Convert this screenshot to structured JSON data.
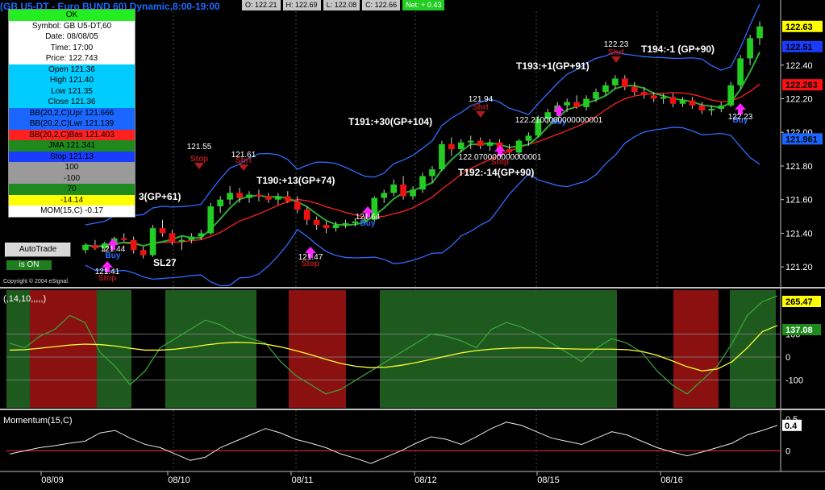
{
  "header": {
    "title": "(GB U5-DT - Euro BUND 60) Dynamic,8:00-19:00",
    "open": "O: 122.21",
    "high": "H: 122.69",
    "low": "L: 122.08",
    "close": "C: 122.66",
    "net": "Net: + 0.43"
  },
  "cursor_window": {
    "rows": [
      {
        "text": "OK",
        "bg": "#22ee22"
      },
      {
        "text": "Symbol: GB U5-DT,60",
        "bg": "#ffffff"
      },
      {
        "text": "Date: 08/08/05",
        "bg": "#ffffff"
      },
      {
        "text": "Time: 17:00",
        "bg": "#ffffff"
      },
      {
        "text": "Price: 122.743",
        "bg": "#ffffff"
      },
      {
        "text": "Open 121.36",
        "bg": "#00ccff"
      },
      {
        "text": "High 121.40",
        "bg": "#00ccff"
      },
      {
        "text": "Low 121.35",
        "bg": "#00ccff"
      },
      {
        "text": "Close 121.36",
        "bg": "#00ccff"
      },
      {
        "text": "BB(20,2,C)Upr 121.666",
        "bg": "#1a66ff"
      },
      {
        "text": "BB(20,2,C)Lwr 121.139",
        "bg": "#1a66ff"
      },
      {
        "text": "BB(20,2,C)Bas 121.403",
        "bg": "#ff2020"
      },
      {
        "text": "JMA 121.341",
        "bg": "#1e8a1e"
      },
      {
        "text": "Stop 121.13",
        "bg": "#1a3cff"
      },
      {
        "text": "100",
        "bg": "#9a9a9a"
      },
      {
        "text": "-100",
        "bg": "#9a9a9a"
      },
      {
        "text": "70",
        "bg": "#1e8a1e"
      },
      {
        "text": "-14.14",
        "bg": "#ffff00"
      },
      {
        "text": "MOM(15,C)  -0.17",
        "bg": "#ffffff"
      }
    ]
  },
  "controls": {
    "autotrade_label": "AutoTrade",
    "status_label": "is ON",
    "copyright": "Copyright © 2004 eSignal."
  },
  "chart_data": [
    {
      "type": "candlestick",
      "price_axis_ticks": [
        122.4,
        122.2,
        122.0,
        121.8,
        121.6,
        121.4,
        121.2
      ],
      "price_tags": [
        {
          "label": "122.63",
          "value": 122.63,
          "color": "#ffff00",
          "text": "#000000"
        },
        {
          "label": "122.51",
          "value": 122.51,
          "color": "#1a3cff",
          "text": "#000000"
        },
        {
          "label": "122.283",
          "value": 122.283,
          "color": "#ff1010",
          "text": "#000000"
        },
        {
          "label": "121.961",
          "value": 121.961,
          "color": "#1a66ff",
          "text": "#000000"
        }
      ],
      "trade_labels": [
        {
          "text": "T190:+13(GP+74)"
        },
        {
          "text": "T191:+30(GP+104)"
        },
        {
          "text": "T192:-14(GP+90)"
        },
        {
          "text": "T193:+1(GP+91)"
        },
        {
          "text": "T194:-1 (GP+90)"
        },
        {
          "text": "3(GP+61)"
        },
        {
          "text": "SL27"
        }
      ],
      "markers": [
        {
          "text": "Stop",
          "kind": "stop-short",
          "price": "121.55"
        },
        {
          "text": "Shrt",
          "kind": "short",
          "price": "121.61"
        },
        {
          "text": "Stop",
          "kind": "stop-long",
          "price": "121.41"
        },
        {
          "text": "Stop",
          "kind": "stop-long",
          "price": "121.47"
        },
        {
          "text": "Buy",
          "kind": "buy",
          "price": "121.64"
        },
        {
          "text": "Buy",
          "kind": "buy",
          "price": "121.44"
        },
        {
          "text": "Shrt",
          "kind": "short",
          "price": "121.94"
        },
        {
          "text": "Stop",
          "kind": "stop-long",
          "price": "122.070000000000001"
        },
        {
          "text": "Buy",
          "kind": "buy",
          "price": "122.2100000000000001"
        },
        {
          "text": "Shrt",
          "kind": "short",
          "price": "122.23"
        },
        {
          "text": "Buy",
          "kind": "buy",
          "price": "122.23"
        }
      ],
      "candles": [
        [
          121.3,
          121.34,
          121.28,
          121.33
        ],
        [
          121.33,
          121.36,
          121.3,
          121.31
        ],
        [
          121.31,
          121.35,
          121.29,
          121.34
        ],
        [
          121.34,
          121.38,
          121.32,
          121.37
        ],
        [
          121.37,
          121.4,
          121.35,
          121.36
        ],
        [
          121.36,
          121.38,
          121.28,
          121.3
        ],
        [
          121.3,
          121.32,
          121.25,
          121.27
        ],
        [
          121.27,
          121.45,
          121.26,
          121.43
        ],
        [
          121.43,
          121.48,
          121.38,
          121.4
        ],
        [
          121.4,
          121.42,
          121.33,
          121.35
        ],
        [
          121.35,
          121.38,
          121.3,
          121.36
        ],
        [
          121.36,
          121.4,
          121.34,
          121.38
        ],
        [
          121.38,
          121.42,
          121.36,
          121.4
        ],
        [
          121.4,
          121.58,
          121.39,
          121.56
        ],
        [
          121.56,
          121.62,
          121.52,
          121.6
        ],
        [
          121.6,
          121.68,
          121.57,
          121.64
        ],
        [
          121.64,
          121.67,
          121.58,
          121.61
        ],
        [
          121.61,
          121.65,
          121.58,
          121.63
        ],
        [
          121.63,
          121.66,
          121.59,
          121.62
        ],
        [
          121.62,
          121.64,
          121.58,
          121.6
        ],
        [
          121.6,
          121.64,
          121.57,
          121.62
        ],
        [
          121.62,
          121.65,
          121.58,
          121.59
        ],
        [
          121.59,
          121.62,
          121.52,
          121.54
        ],
        [
          121.54,
          121.56,
          121.45,
          121.48
        ],
        [
          121.48,
          121.5,
          121.42,
          121.45
        ],
        [
          121.45,
          121.47,
          121.4,
          121.43
        ],
        [
          121.43,
          121.47,
          121.41,
          121.45
        ],
        [
          121.45,
          121.48,
          121.43,
          121.46
        ],
        [
          121.46,
          121.49,
          121.44,
          121.47
        ],
        [
          121.47,
          121.5,
          121.45,
          121.48
        ],
        [
          121.48,
          121.62,
          121.47,
          121.61
        ],
        [
          121.61,
          121.66,
          121.58,
          121.64
        ],
        [
          121.64,
          121.72,
          121.62,
          121.69
        ],
        [
          121.69,
          121.74,
          121.6,
          121.62
        ],
        [
          121.62,
          121.68,
          121.6,
          121.66
        ],
        [
          121.66,
          121.76,
          121.64,
          121.74
        ],
        [
          121.74,
          121.8,
          121.7,
          121.78
        ],
        [
          121.78,
          121.95,
          121.77,
          121.93
        ],
        [
          121.93,
          121.97,
          121.86,
          121.9
        ],
        [
          121.9,
          121.96,
          121.88,
          121.94
        ],
        [
          121.94,
          121.98,
          121.9,
          121.95
        ],
        [
          121.95,
          121.97,
          121.9,
          121.92
        ],
        [
          121.92,
          121.96,
          121.89,
          121.94
        ],
        [
          121.94,
          121.96,
          121.88,
          121.9
        ],
        [
          121.9,
          121.93,
          121.86,
          121.88
        ],
        [
          121.88,
          121.96,
          121.86,
          121.95
        ],
        [
          121.95,
          122.0,
          121.92,
          121.98
        ],
        [
          121.98,
          122.1,
          121.97,
          122.08
        ],
        [
          122.08,
          122.14,
          122.05,
          122.12
        ],
        [
          122.12,
          122.18,
          122.1,
          122.16
        ],
        [
          122.16,
          122.2,
          122.12,
          122.18
        ],
        [
          122.18,
          122.22,
          122.14,
          122.15
        ],
        [
          122.15,
          122.22,
          122.13,
          122.2
        ],
        [
          122.2,
          122.26,
          122.18,
          122.24
        ],
        [
          122.24,
          122.3,
          122.22,
          122.28
        ],
        [
          122.28,
          122.34,
          122.26,
          122.32
        ],
        [
          122.32,
          122.34,
          122.25,
          122.27
        ],
        [
          122.27,
          122.3,
          122.22,
          122.24
        ],
        [
          122.24,
          122.27,
          122.2,
          122.22
        ],
        [
          122.22,
          122.24,
          122.18,
          122.2
        ],
        [
          122.2,
          122.23,
          122.17,
          122.21
        ],
        [
          122.21,
          122.23,
          122.15,
          122.17
        ],
        [
          122.17,
          122.21,
          122.15,
          122.19
        ],
        [
          122.19,
          122.21,
          122.14,
          122.16
        ],
        [
          122.16,
          122.18,
          122.11,
          122.13
        ],
        [
          122.13,
          122.16,
          122.1,
          122.14
        ],
        [
          122.14,
          122.18,
          122.12,
          122.16
        ],
        [
          122.16,
          122.3,
          122.15,
          122.28
        ],
        [
          122.28,
          122.46,
          122.26,
          122.44
        ],
        [
          122.44,
          122.58,
          122.4,
          122.56
        ],
        [
          122.56,
          122.66,
          122.52,
          122.63
        ]
      ]
    },
    {
      "type": "line",
      "label": "(,14,10,,,,,)",
      "axis_ticks": [
        "100",
        "0",
        "-100"
      ],
      "value_tags": [
        {
          "label": "265.47",
          "color": "#ffff00"
        },
        {
          "label": "137.08",
          "color": "#1e8a1e"
        }
      ],
      "cci": [
        60,
        40,
        90,
        120,
        180,
        150,
        20,
        -40,
        -120,
        -60,
        40,
        80,
        120,
        160,
        140,
        100,
        80,
        60,
        -20,
        -80,
        -120,
        -160,
        -140,
        -100,
        -60,
        -20,
        20,
        60,
        100,
        90,
        70,
        40,
        120,
        150,
        130,
        100,
        60,
        20,
        -20,
        40,
        80,
        60,
        20,
        -60,
        -120,
        -160,
        -100,
        -40,
        60,
        180,
        240,
        265
      ],
      "signal": [
        30,
        32,
        38,
        45,
        52,
        56,
        54,
        48,
        38,
        30,
        30,
        34,
        42,
        52,
        60,
        64,
        62,
        56,
        44,
        28,
        10,
        -10,
        -28,
        -40,
        -46,
        -44,
        -36,
        -24,
        -10,
        4,
        18,
        28,
        34,
        38,
        40,
        40,
        38,
        36,
        34,
        34,
        34,
        32,
        24,
        8,
        -16,
        -42,
        -60,
        -52,
        -20,
        40,
        110,
        137
      ],
      "zones": [
        {
          "color": "#1e5a1e"
        },
        {
          "color": "#8b1010"
        },
        {
          "color": "#1e5a1e"
        },
        {
          "color": "#000000"
        },
        {
          "color": "#1e5a1e"
        },
        {
          "color": "#000000"
        },
        {
          "color": "#8b1010"
        },
        {
          "color": "#000000"
        },
        {
          "color": "#1e5a1e"
        },
        {
          "color": "#000000"
        },
        {
          "color": "#8b1010"
        },
        {
          "color": "#000000"
        },
        {
          "color": "#1e5a1e"
        }
      ]
    },
    {
      "type": "line",
      "label": "Momentum(15,C)",
      "axis_ticks": [
        "0.5",
        "0"
      ],
      "value_tag": "0.4",
      "values": [
        -0.05,
        0.0,
        0.05,
        0.08,
        0.12,
        0.15,
        0.28,
        0.32,
        0.2,
        0.1,
        0.05,
        -0.05,
        -0.15,
        -0.1,
        0.05,
        0.15,
        0.25,
        0.35,
        0.28,
        0.18,
        0.12,
        0.05,
        -0.05,
        -0.12,
        -0.2,
        -0.1,
        0.0,
        0.12,
        0.22,
        0.18,
        0.1,
        0.22,
        0.35,
        0.45,
        0.4,
        0.3,
        0.2,
        0.15,
        0.1,
        0.2,
        0.3,
        0.25,
        0.15,
        0.05,
        -0.02,
        -0.08,
        -0.02,
        0.05,
        0.12,
        0.25,
        0.32,
        0.4
      ]
    }
  ],
  "x_axis": {
    "dates": [
      "08/09",
      "08/10",
      "08/11",
      "08/12",
      "08/15",
      "08/16"
    ]
  }
}
